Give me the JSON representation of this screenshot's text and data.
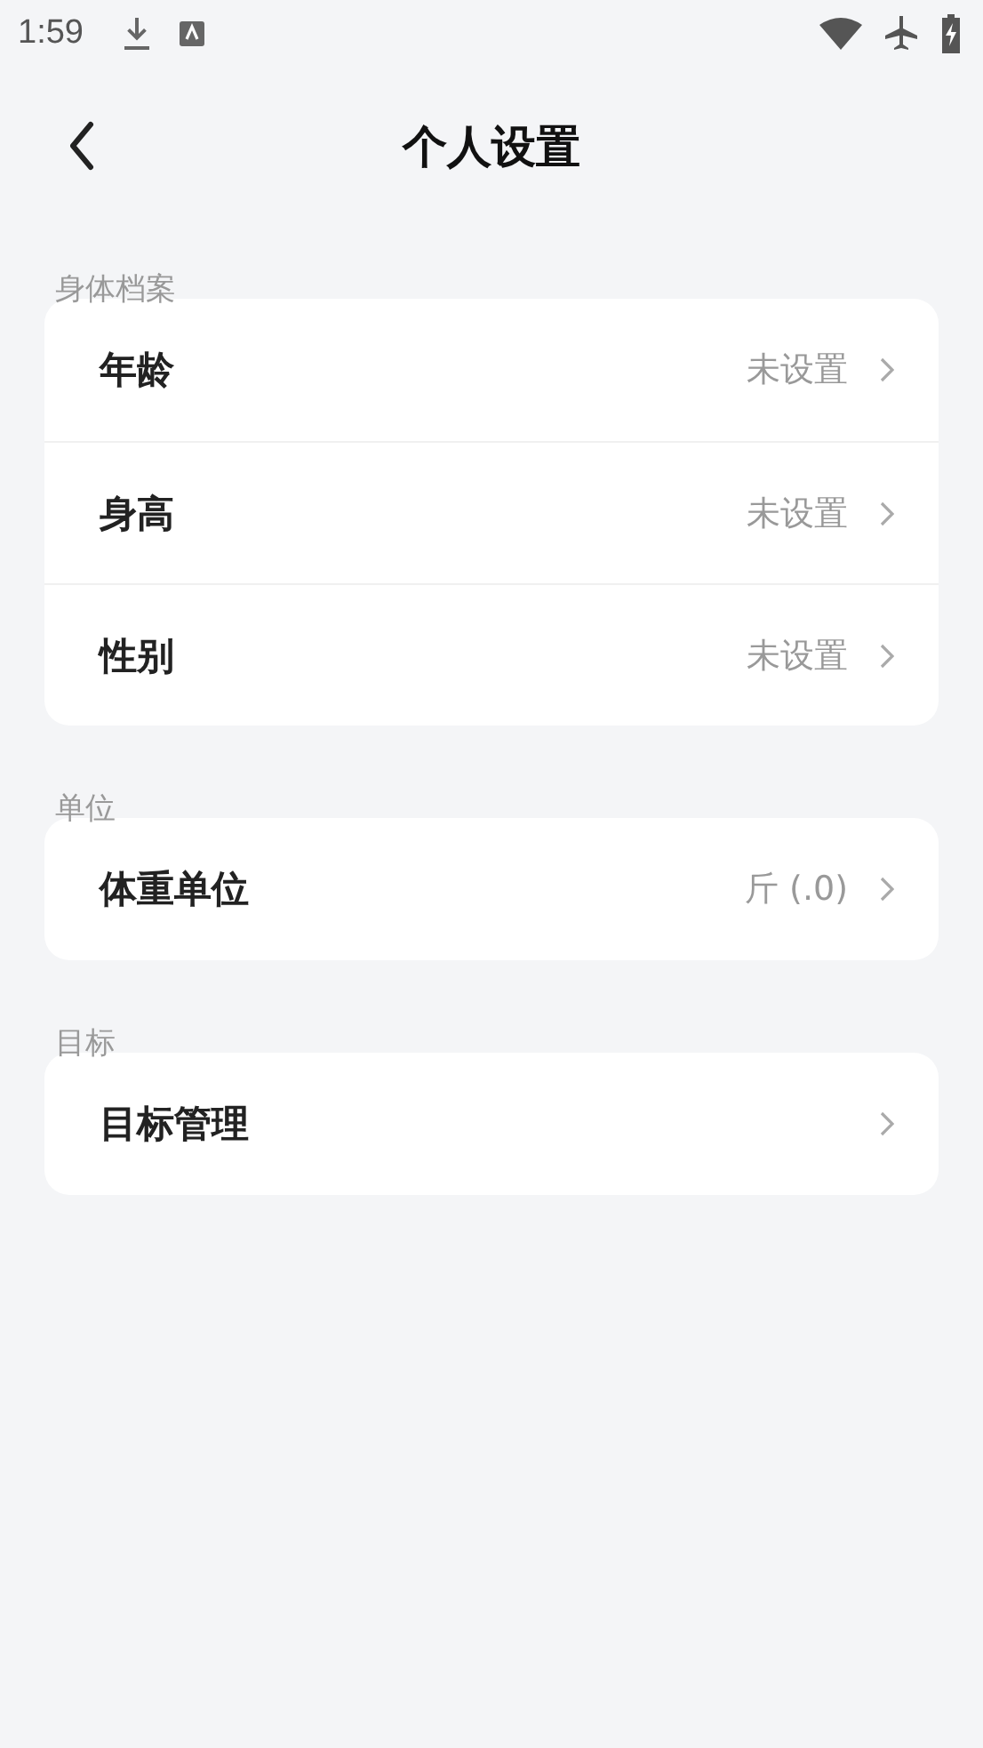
{
  "status_bar": {
    "time": "1:59"
  },
  "header": {
    "title": "个人设置"
  },
  "sections": [
    {
      "title": "身体档案",
      "rows": [
        {
          "label": "年龄",
          "value": "未设置"
        },
        {
          "label": "身高",
          "value": "未设置"
        },
        {
          "label": "性别",
          "value": "未设置"
        }
      ]
    },
    {
      "title": "单位",
      "rows": [
        {
          "label": "体重单位",
          "value": "斤 (.0)"
        }
      ]
    },
    {
      "title": "目标",
      "rows": [
        {
          "label": "目标管理"
        }
      ]
    }
  ]
}
